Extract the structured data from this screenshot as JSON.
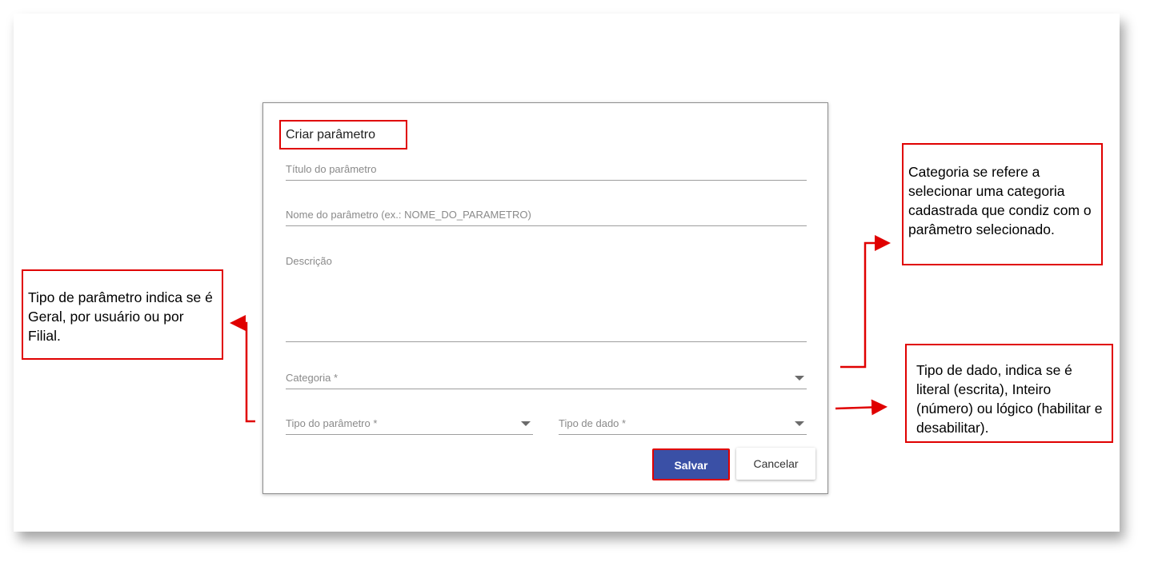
{
  "dialog": {
    "title": "Criar parâmetro",
    "fields": {
      "titulo": "Título do parâmetro",
      "nome": "Nome do parâmetro (ex.: NOME_DO_PARAMETRO)",
      "descricao": "Descrição",
      "categoria": "Categoria *",
      "tipo_parametro": "Tipo do parâmetro *",
      "tipo_dado": "Tipo de dado *"
    },
    "buttons": {
      "save": "Salvar",
      "cancel": "Cancelar"
    }
  },
  "annotations": {
    "tipo_parametro": " Tipo de parâmetro indica se é Geral, por usuário ou por Filial.",
    "categoria": " Categoria se refere a selecionar uma categoria cadastrada que condiz com o parâmetro selecionado.",
    "tipo_dado": "  Tipo de dado, indica se é literal (escrita), Inteiro (número) ou lógico (habilitar e desabilitar)."
  },
  "colors": {
    "accent": "#3a50a6",
    "annotation": "#e00000"
  }
}
